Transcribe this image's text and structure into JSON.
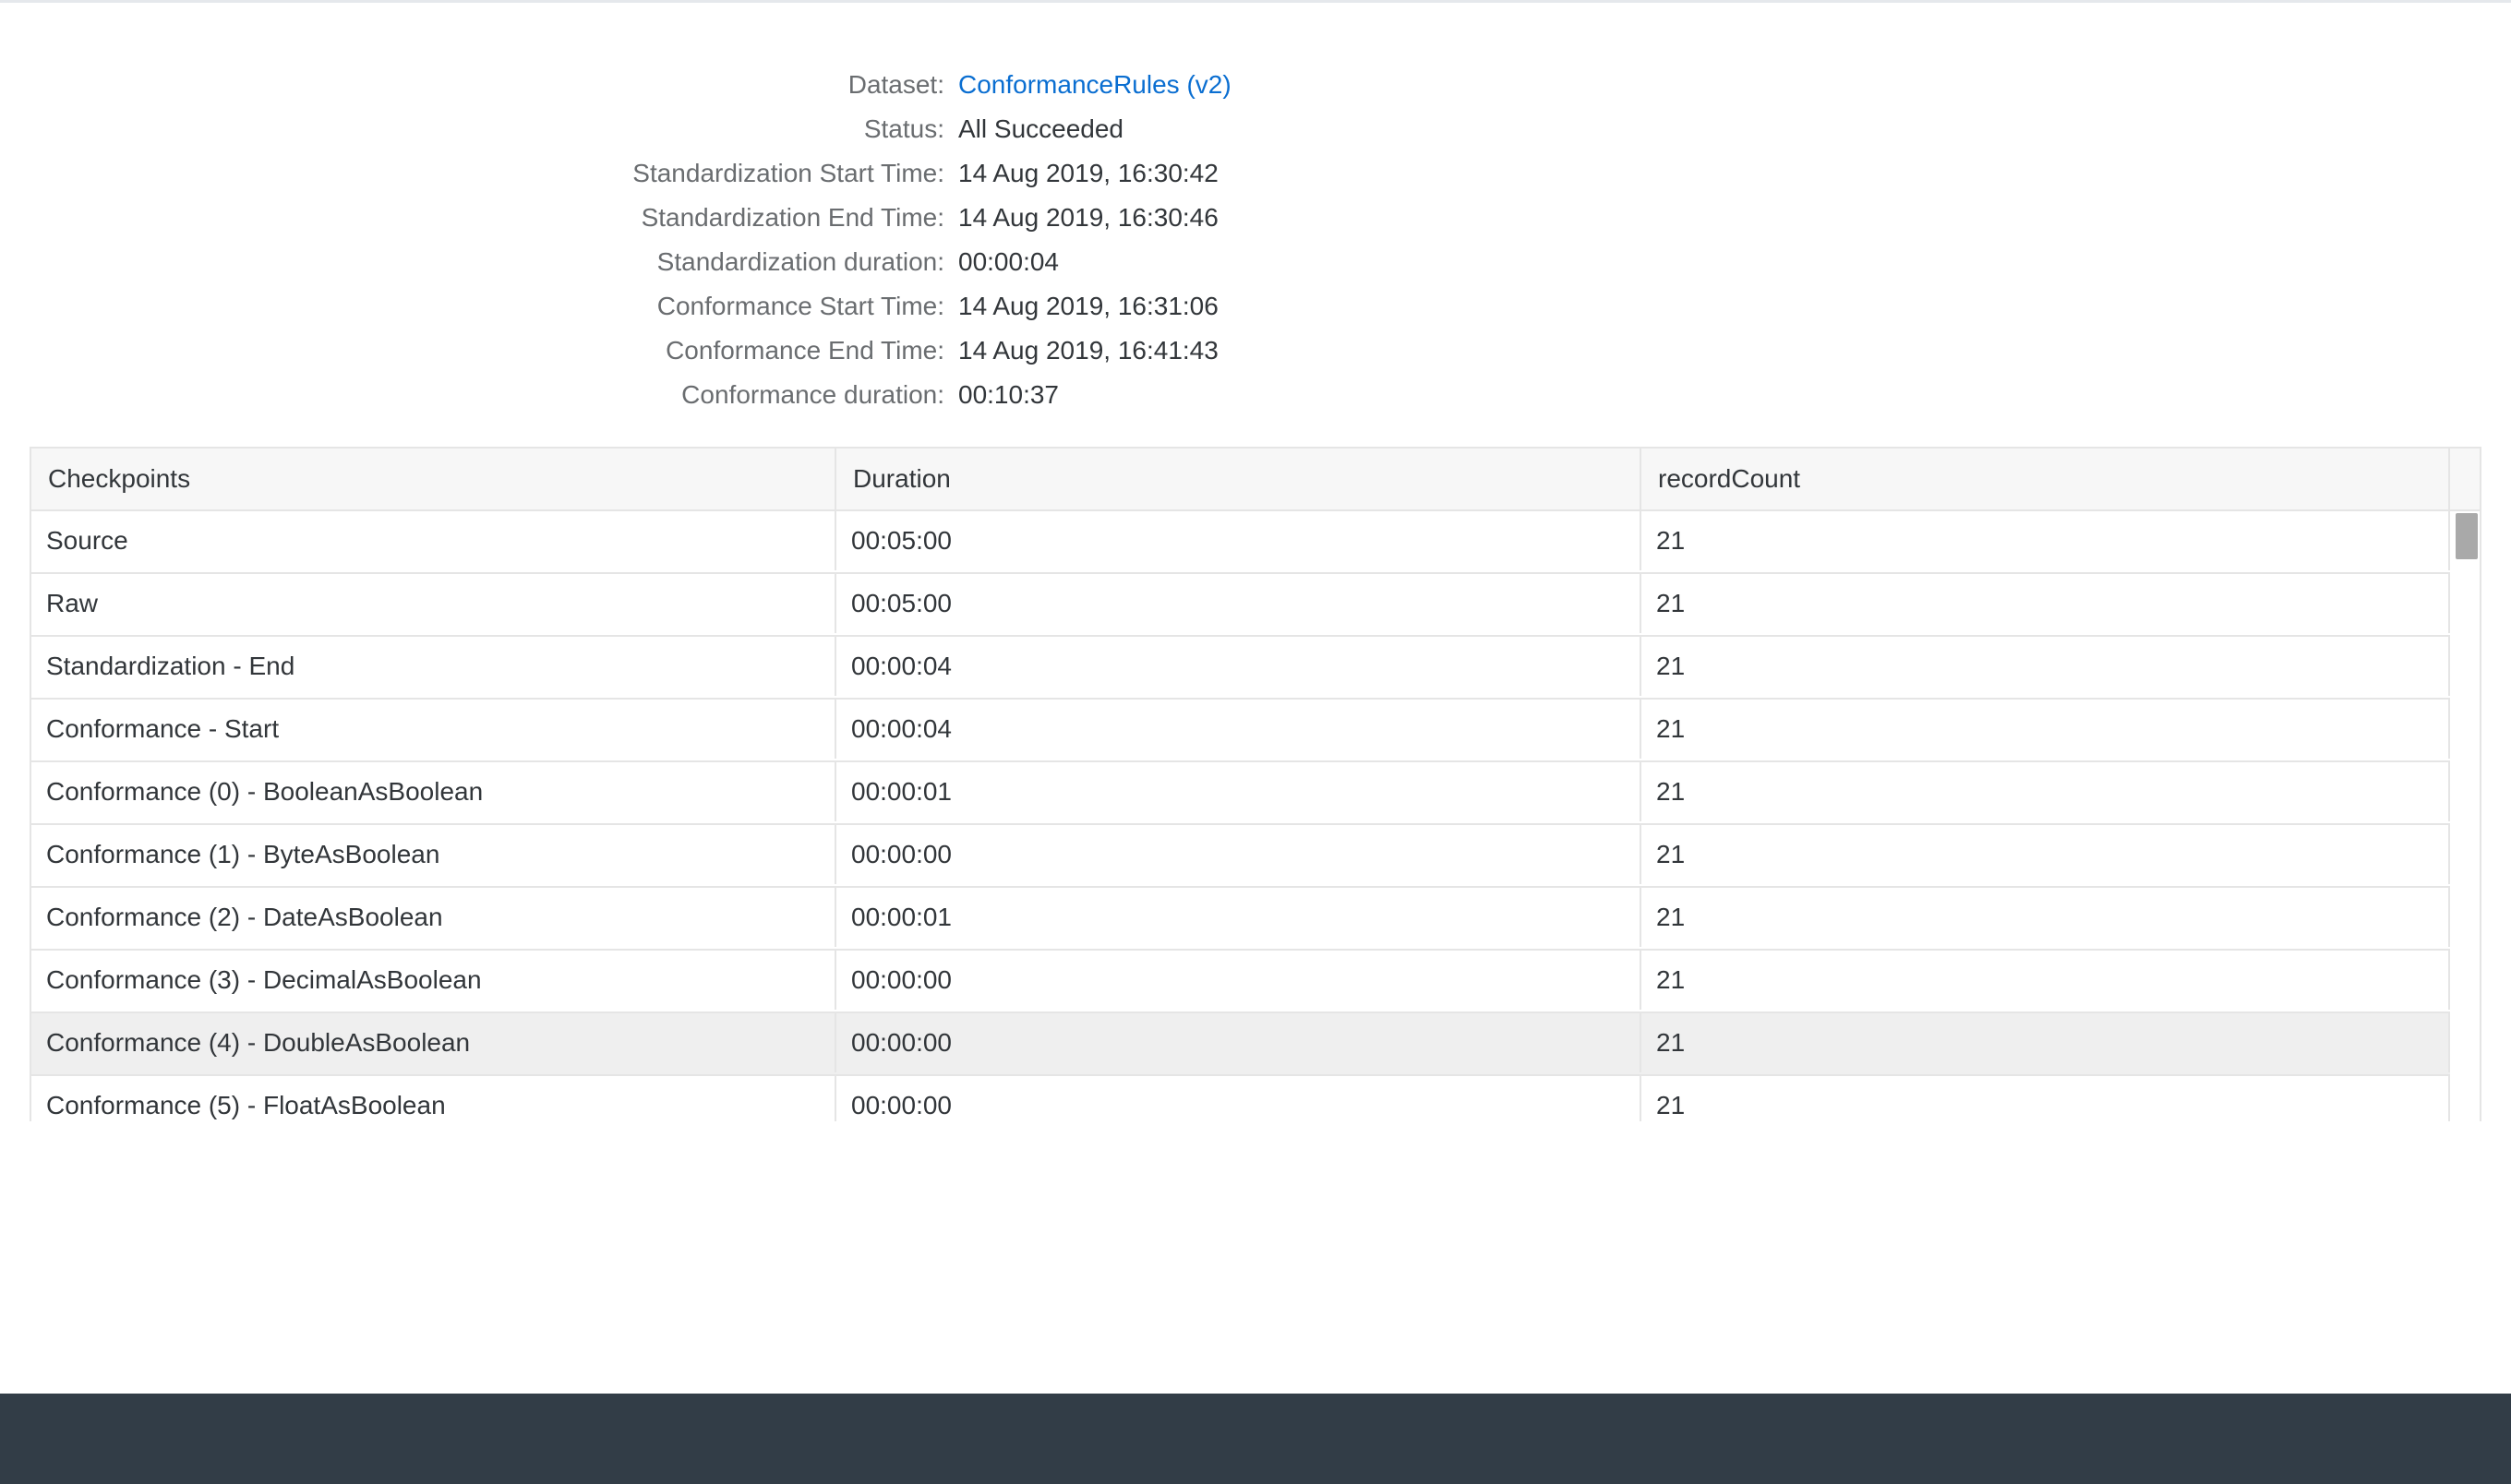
{
  "info": [
    {
      "label": "Dataset:",
      "value": "ConformanceRules (v2)",
      "link": true
    },
    {
      "label": "Status:",
      "value": "All Succeeded",
      "link": false
    },
    {
      "label": "Standardization Start Time:",
      "value": "14 Aug 2019, 16:30:42",
      "link": false
    },
    {
      "label": "Standardization End Time:",
      "value": "14 Aug 2019, 16:30:46",
      "link": false
    },
    {
      "label": "Standardization duration:",
      "value": "00:00:04",
      "link": false
    },
    {
      "label": "Conformance Start Time:",
      "value": "14 Aug 2019, 16:31:06",
      "link": false
    },
    {
      "label": "Conformance End Time:",
      "value": "14 Aug 2019, 16:41:43",
      "link": false
    },
    {
      "label": "Conformance duration:",
      "value": "00:10:37",
      "link": false
    }
  ],
  "table": {
    "columns": [
      "Checkpoints",
      "Duration",
      "recordCount"
    ],
    "rows": [
      [
        "Source",
        "00:05:00",
        "21"
      ],
      [
        "Raw",
        "00:05:00",
        "21"
      ],
      [
        "Standardization - End",
        "00:00:04",
        "21"
      ],
      [
        "Conformance - Start",
        "00:00:04",
        "21"
      ],
      [
        "Conformance (0) - BooleanAsBoolean",
        "00:00:01",
        "21"
      ],
      [
        "Conformance (1) - ByteAsBoolean",
        "00:00:00",
        "21"
      ],
      [
        "Conformance (2) - DateAsBoolean",
        "00:00:01",
        "21"
      ],
      [
        "Conformance (3) - DecimalAsBoolean",
        "00:00:00",
        "21"
      ],
      [
        "Conformance (4) - DoubleAsBoolean",
        "00:00:00",
        "21"
      ],
      [
        "Conformance (5) - FloatAsBoolean",
        "00:00:00",
        "21"
      ]
    ],
    "hovered_row_index": 8
  },
  "colors": {
    "link": "#0a6ed1",
    "footer": "#323d47",
    "header_bg": "#f7f7f7",
    "hover_row_bg": "#efefef"
  }
}
